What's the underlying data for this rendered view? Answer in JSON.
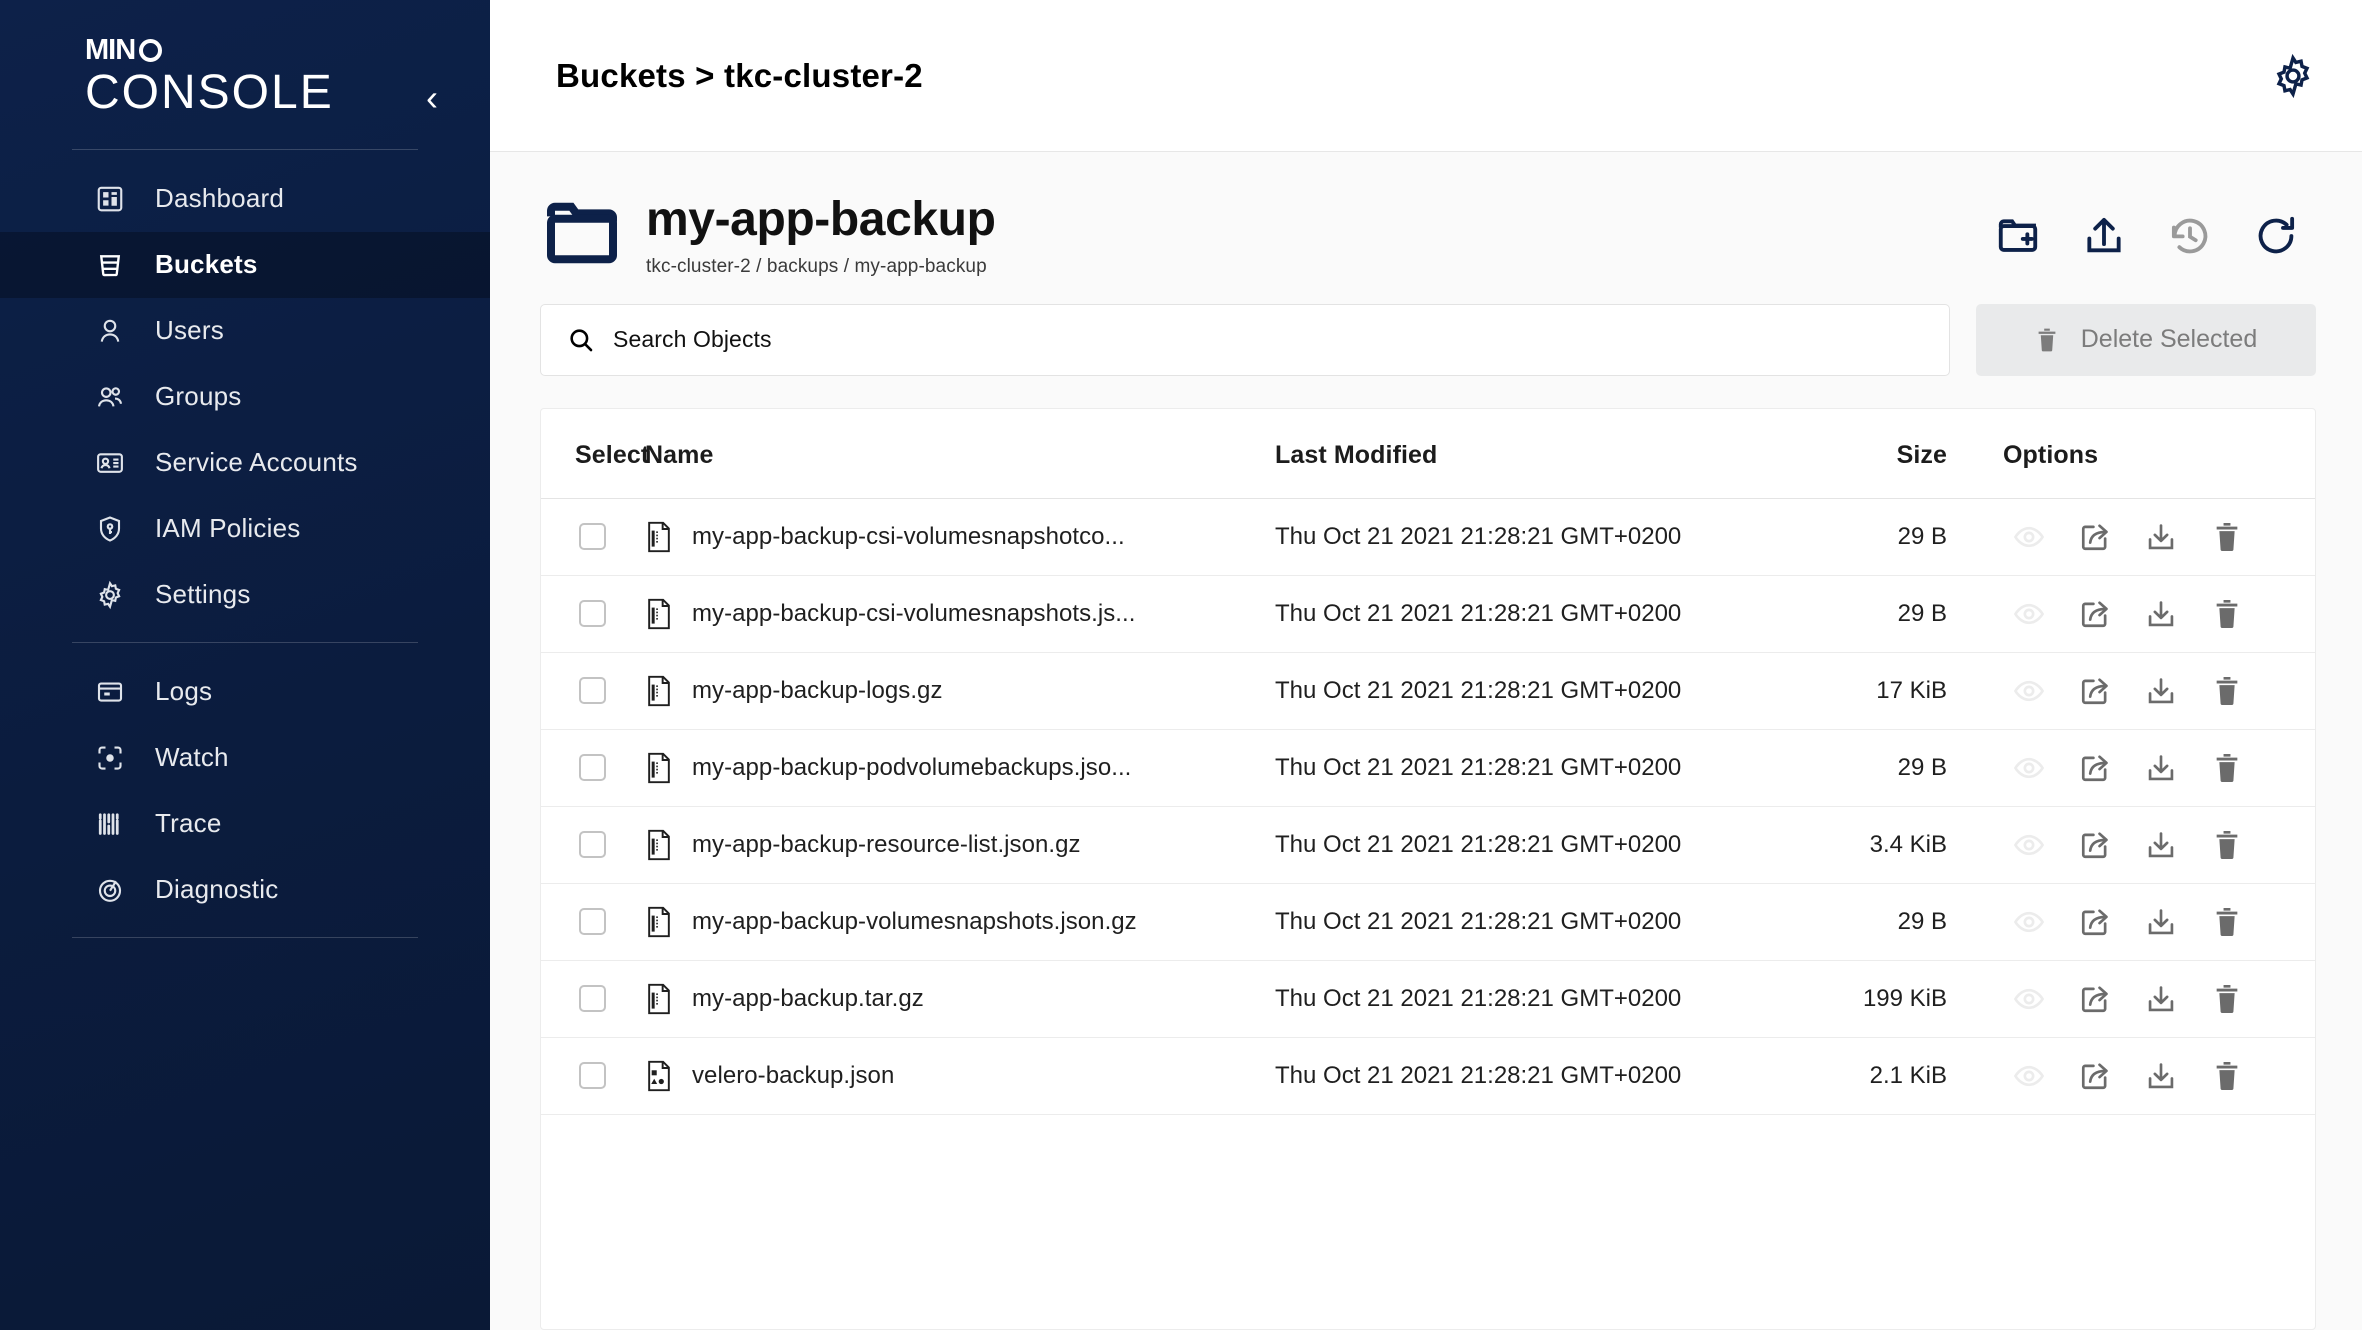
{
  "sidebar": {
    "logo_mini": "MIN",
    "logo_io": "IO",
    "logo_console": "CONSOLE",
    "collapse_icon": "chevron-left-icon",
    "items": [
      {
        "label": "Dashboard",
        "icon": "dashboard-icon",
        "active": false
      },
      {
        "label": "Buckets",
        "icon": "bucket-icon",
        "active": true
      },
      {
        "label": "Users",
        "icon": "user-icon",
        "active": false
      },
      {
        "label": "Groups",
        "icon": "groups-icon",
        "active": false
      },
      {
        "label": "Service Accounts",
        "icon": "id-card-icon",
        "active": false
      },
      {
        "label": "IAM Policies",
        "icon": "shield-key-icon",
        "active": false
      },
      {
        "label": "Settings",
        "icon": "gear-icon",
        "active": false
      }
    ],
    "items_secondary": [
      {
        "label": "Logs",
        "icon": "logs-icon",
        "active": false
      },
      {
        "label": "Watch",
        "icon": "watch-icon",
        "active": false
      },
      {
        "label": "Trace",
        "icon": "trace-icon",
        "active": false
      },
      {
        "label": "Diagnostic",
        "icon": "diagnostic-icon",
        "active": false
      }
    ]
  },
  "header": {
    "breadcrumb": "Buckets > tkc-cluster-2",
    "settings_icon": "gear-icon"
  },
  "bucket": {
    "title": "my-app-backup",
    "path": "tkc-cluster-2 / backups / my-app-backup",
    "folder_icon": "folder-icon",
    "actions": [
      {
        "name": "create-folder-button",
        "icon": "folder-plus-icon",
        "disabled": false
      },
      {
        "name": "upload-button",
        "icon": "upload-icon",
        "disabled": false
      },
      {
        "name": "version-history-button",
        "icon": "history-icon",
        "disabled": true
      },
      {
        "name": "refresh-button",
        "icon": "refresh-icon",
        "disabled": false
      }
    ]
  },
  "search": {
    "placeholder": "Search Objects",
    "value": "",
    "icon": "search-icon"
  },
  "delete_selected": {
    "label": "Delete Selected",
    "icon": "trash-icon",
    "disabled": true
  },
  "table": {
    "columns": [
      "Select",
      "Name",
      "Last Modified",
      "Size",
      "Options"
    ],
    "rows": [
      {
        "name": "my-app-backup-csi-volumesnapshotco...",
        "modified": "Thu Oct 21 2021 21:28:21 GMT+0200",
        "size": "29 B",
        "icon": "file-code-icon",
        "selected": false
      },
      {
        "name": "my-app-backup-csi-volumesnapshots.js...",
        "modified": "Thu Oct 21 2021 21:28:21 GMT+0200",
        "size": "29 B",
        "icon": "file-code-icon",
        "selected": false
      },
      {
        "name": "my-app-backup-logs.gz",
        "modified": "Thu Oct 21 2021 21:28:21 GMT+0200",
        "size": "17 KiB",
        "icon": "file-code-icon",
        "selected": false
      },
      {
        "name": "my-app-backup-podvolumebackups.jso...",
        "modified": "Thu Oct 21 2021 21:28:21 GMT+0200",
        "size": "29 B",
        "icon": "file-code-icon",
        "selected": false
      },
      {
        "name": "my-app-backup-resource-list.json.gz",
        "modified": "Thu Oct 21 2021 21:28:21 GMT+0200",
        "size": "3.4 KiB",
        "icon": "file-code-icon",
        "selected": false
      },
      {
        "name": "my-app-backup-volumesnapshots.json.gz",
        "modified": "Thu Oct 21 2021 21:28:21 GMT+0200",
        "size": "29 B",
        "icon": "file-code-icon",
        "selected": false
      },
      {
        "name": "my-app-backup.tar.gz",
        "modified": "Thu Oct 21 2021 21:28:21 GMT+0200",
        "size": "199 KiB",
        "icon": "file-code-icon",
        "selected": false
      },
      {
        "name": "velero-backup.json",
        "modified": "Thu Oct 21 2021 21:28:21 GMT+0200",
        "size": "2.1 KiB",
        "icon": "file-shapes-icon",
        "selected": false
      }
    ],
    "row_actions": [
      {
        "name": "preview-button",
        "icon": "eye-icon",
        "disabled": true
      },
      {
        "name": "share-button",
        "icon": "share-icon",
        "disabled": false
      },
      {
        "name": "download-button",
        "icon": "download-icon",
        "disabled": false
      },
      {
        "name": "delete-button",
        "icon": "trash-icon",
        "disabled": false
      }
    ]
  },
  "colors": {
    "sidebar_bg": "#0b1c3e",
    "accent_navy": "#0d2149",
    "page_bg": "#fafafa",
    "muted": "#6b6b6b",
    "disabled": "#9a9a9a"
  }
}
